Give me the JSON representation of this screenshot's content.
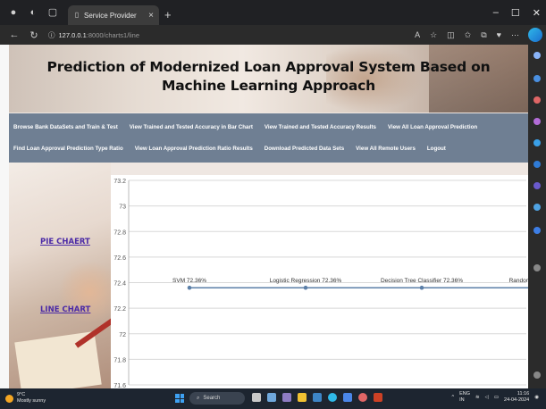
{
  "browser": {
    "tab_title": "Service Provider",
    "url_host": "127.0.0.1",
    "url_path": ":8000/charts1/line"
  },
  "page": {
    "title": "Prediction of Modernized Loan Approval System Based on Machine Learning Approach",
    "menu_row1": [
      "Browse Bank DataSets and Train & Test",
      "View Trained and Tested Accuracy in Bar Chart",
      "View Trained and Tested Accuracy Results",
      "View All Loan Approval Prediction"
    ],
    "menu_row2": [
      "Find Loan Approval Prediction Type Ratio",
      "View Loan Approval Prediction Ratio Results",
      "Download Predicted Data Sets",
      "View All Remote Users",
      "Logout"
    ],
    "pie_chart_link": "PIE CHAERT",
    "line_chart_link": "LINE CHART"
  },
  "chart_data": {
    "type": "line",
    "categories": [
      "SVM",
      "Logistic Regression",
      "Decision Tree Classifier",
      "Random Forest"
    ],
    "values": [
      72.36,
      72.36,
      72.36,
      72.36
    ],
    "data_labels": [
      "SVM 72.36%",
      "Logistic Regression 72.36%",
      "Decision Tree Classifier 72.36%",
      "Random Forest"
    ],
    "y_ticks": [
      "73.2",
      "73",
      "72.8",
      "72.6",
      "72.4",
      "72.2",
      "72",
      "71.8",
      "71.6"
    ],
    "ylim": [
      71.6,
      73.2
    ],
    "grid": true,
    "line_color": "#5b7fa8"
  },
  "taskbar": {
    "weather_temp": "9°C",
    "weather_desc": "Mostly sunny",
    "search_label": "Search",
    "lang": "ENG",
    "region": "IN",
    "time": "11:16",
    "date": "24-04-2024"
  }
}
